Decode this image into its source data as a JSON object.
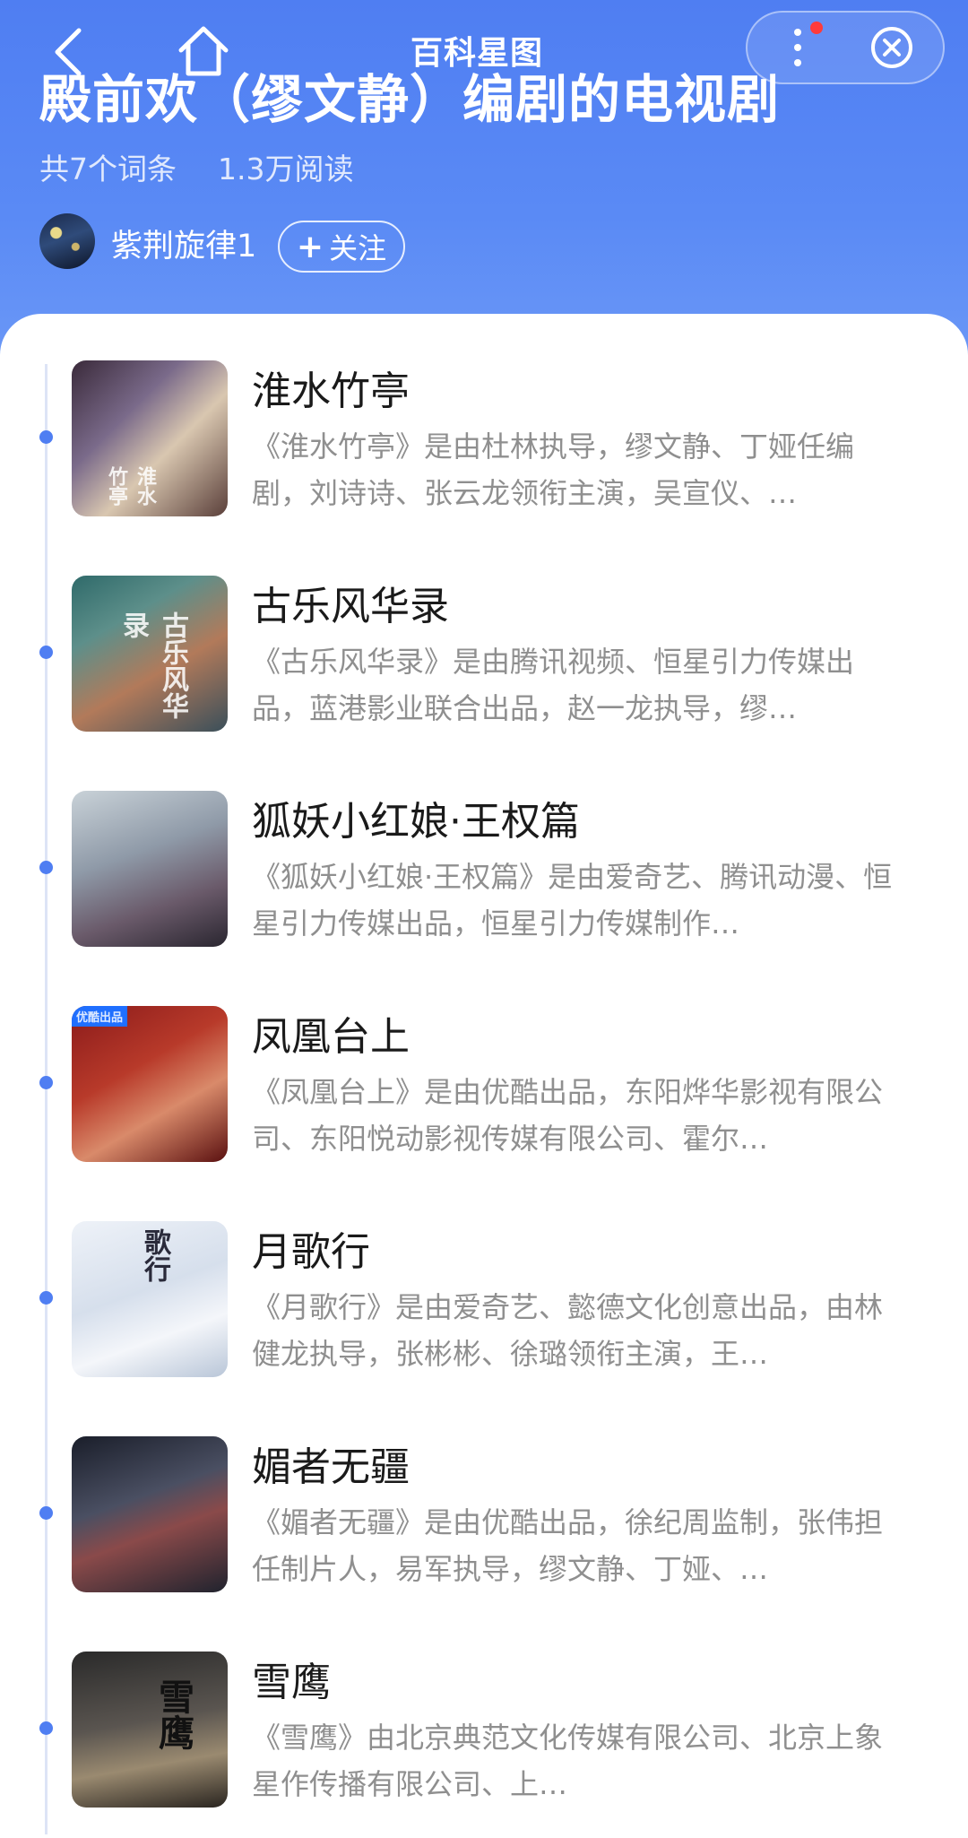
{
  "header": {
    "app_title": "百科星图",
    "page_title": "殿前欢（缪文静）编剧的电视剧",
    "entry_count": "共7个词条",
    "read_count": "1.3万阅读",
    "author": "紫荆旋律1",
    "follow_label": "关注",
    "follow_plus": "+",
    "notification_dot_color": "#ff3b3b",
    "accent_color": "#4f7ef2"
  },
  "items": [
    {
      "title": "淮水竹亭",
      "desc": "《淮水竹亭》是由杜林执导，缪文静、丁娅任编剧，刘诗诗、张云龙领衔主演，吴宣仪、…"
    },
    {
      "title": "古乐风华录",
      "desc": "《古乐风华录》是由腾讯视频、恒星引力传媒出品，蓝港影业联合出品，赵一龙执导，缪…"
    },
    {
      "title": "狐妖小红娘·王权篇",
      "desc": "《狐妖小红娘·王权篇》是由爱奇艺、腾讯动漫、恒星引力传媒出品，恒星引力传媒制作…"
    },
    {
      "title": "凤凰台上",
      "desc": "《凤凰台上》是由优酷出品，东阳烨华影视有限公司、东阳悦动影视传媒有限公司、霍尔…"
    },
    {
      "title": "月歌行",
      "desc": "《月歌行》是由爱奇艺、懿德文化创意出品，由林健龙执导，张彬彬、徐璐领衔主演，王…"
    },
    {
      "title": "媚者无疆",
      "desc": "《媚者无疆》是由优酷出品，徐纪周监制，张伟担任制片人，易军执导，缪文静、丁娅、…"
    },
    {
      "title": "雪鹰",
      "desc": "《雪鹰》由北京典范文化传媒有限公司、北京上象星作传播有限公司、上…"
    }
  ],
  "poster_texts": [
    "淮水竹亭",
    "古乐风华录",
    "",
    "优酷出品",
    "歌行",
    "",
    "雪鹰"
  ]
}
